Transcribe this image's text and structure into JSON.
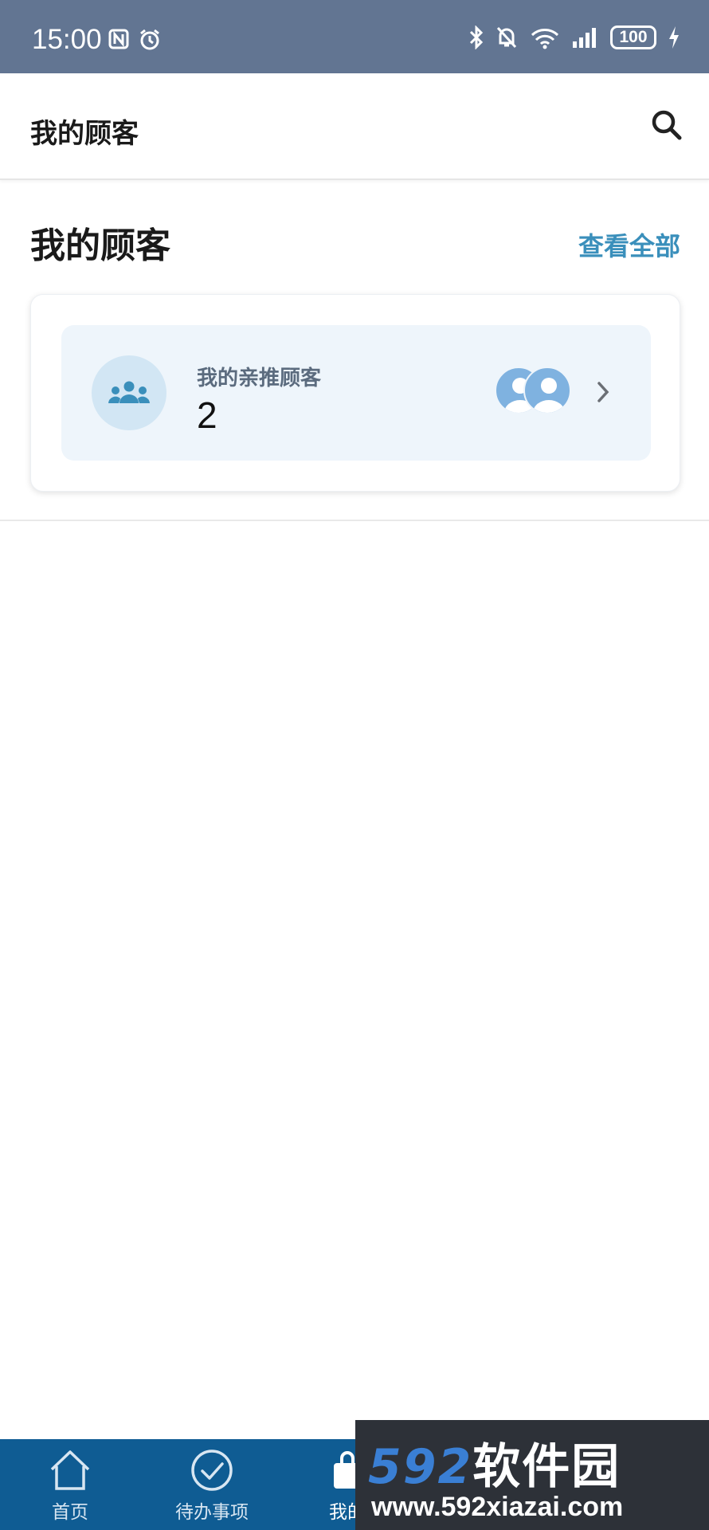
{
  "status_bar": {
    "time": "15:00",
    "battery": "100",
    "icons": [
      "nfc-icon",
      "alarm-icon",
      "bluetooth-icon",
      "mute-icon",
      "wifi-icon",
      "signal-icon",
      "battery-icon",
      "charging-icon"
    ]
  },
  "header": {
    "title": "我的顾客",
    "search_icon": "search-icon"
  },
  "section": {
    "title": "我的顾客",
    "view_all": "查看全部"
  },
  "card": {
    "label": "我的亲推顾客",
    "count": "2",
    "icon": "group-icon"
  },
  "bottom_nav": {
    "items": [
      {
        "label": "首页",
        "icon": "home-icon"
      },
      {
        "label": "待办事项",
        "icon": "check-circle-icon"
      },
      {
        "label": "我的",
        "icon": "bag-icon"
      }
    ]
  },
  "watermark": {
    "logo_digits": "592",
    "logo_text": "软件园",
    "url": "www.592xiazai.com"
  },
  "colors": {
    "status_bar": "#627592",
    "accent": "#3a8fbb",
    "nav_bar": "#0f5c93",
    "card_inner": "#eef5fb"
  }
}
